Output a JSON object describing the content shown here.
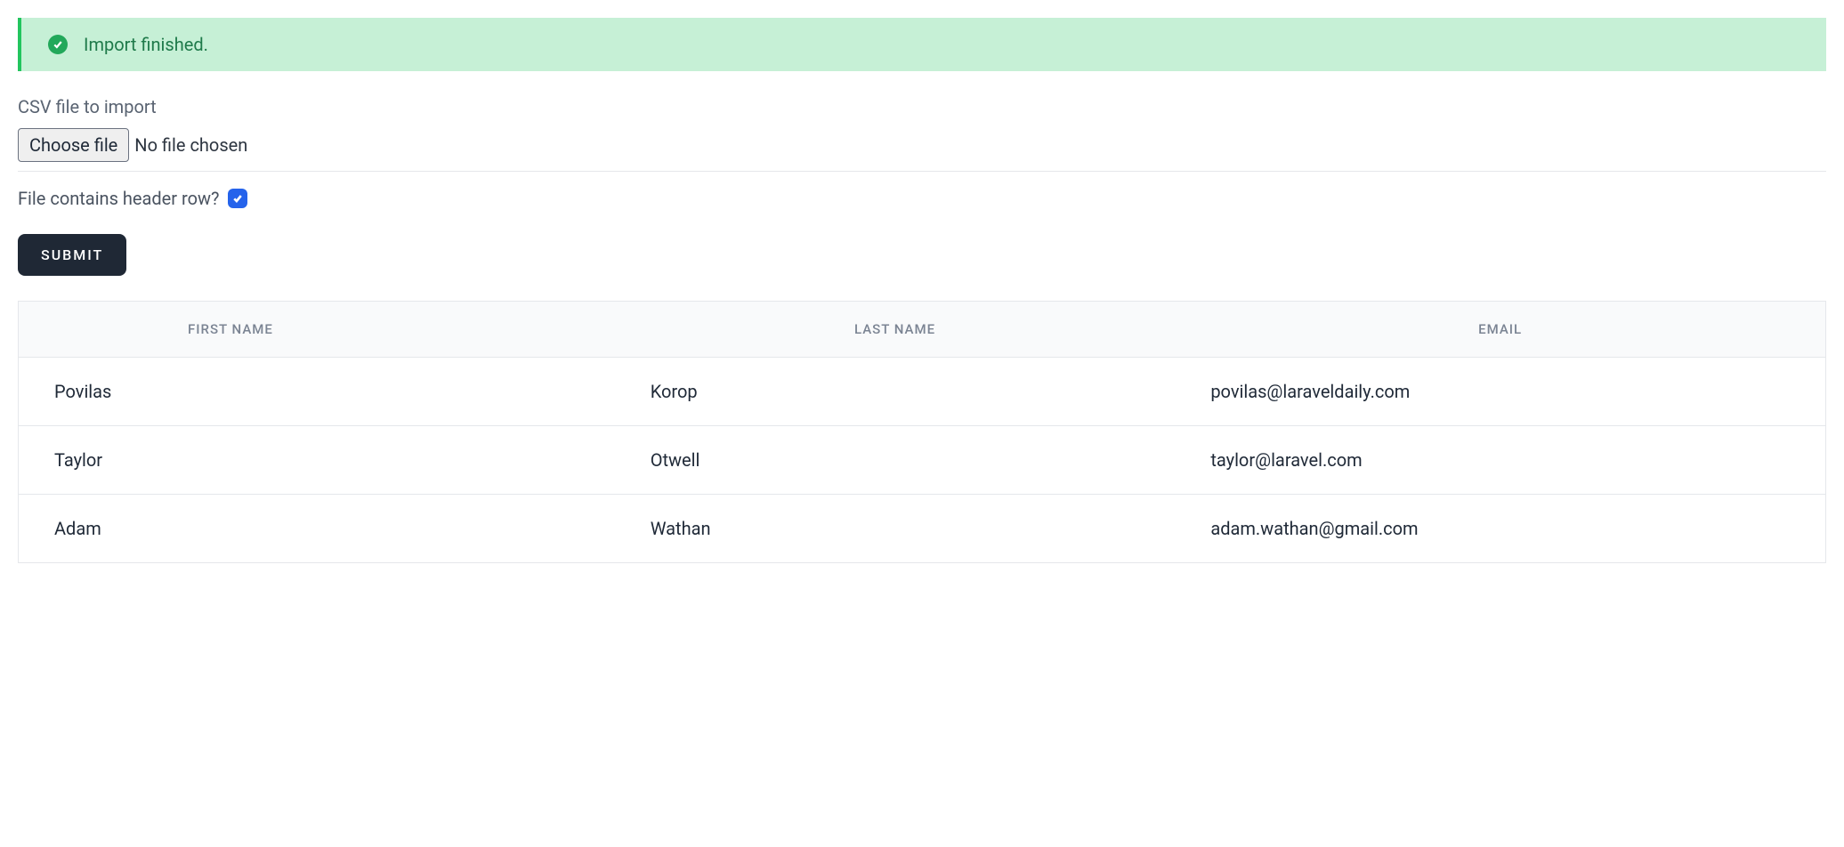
{
  "alert": {
    "message": "Import finished."
  },
  "form": {
    "csv_file_label": "CSV file to import",
    "choose_file_label": "Choose file",
    "file_status": "No file chosen",
    "header_row_label": "File contains header row?",
    "header_row_checked": true,
    "submit_label": "SUBMIT"
  },
  "table": {
    "headers": {
      "first_name": "FIRST NAME",
      "last_name": "LAST NAME",
      "email": "EMAIL"
    },
    "rows": [
      {
        "first_name": "Povilas",
        "last_name": "Korop",
        "email": "povilas@laraveldaily.com"
      },
      {
        "first_name": "Taylor",
        "last_name": "Otwell",
        "email": "taylor@laravel.com"
      },
      {
        "first_name": "Adam",
        "last_name": "Wathan",
        "email": "adam.wathan@gmail.com"
      }
    ]
  }
}
